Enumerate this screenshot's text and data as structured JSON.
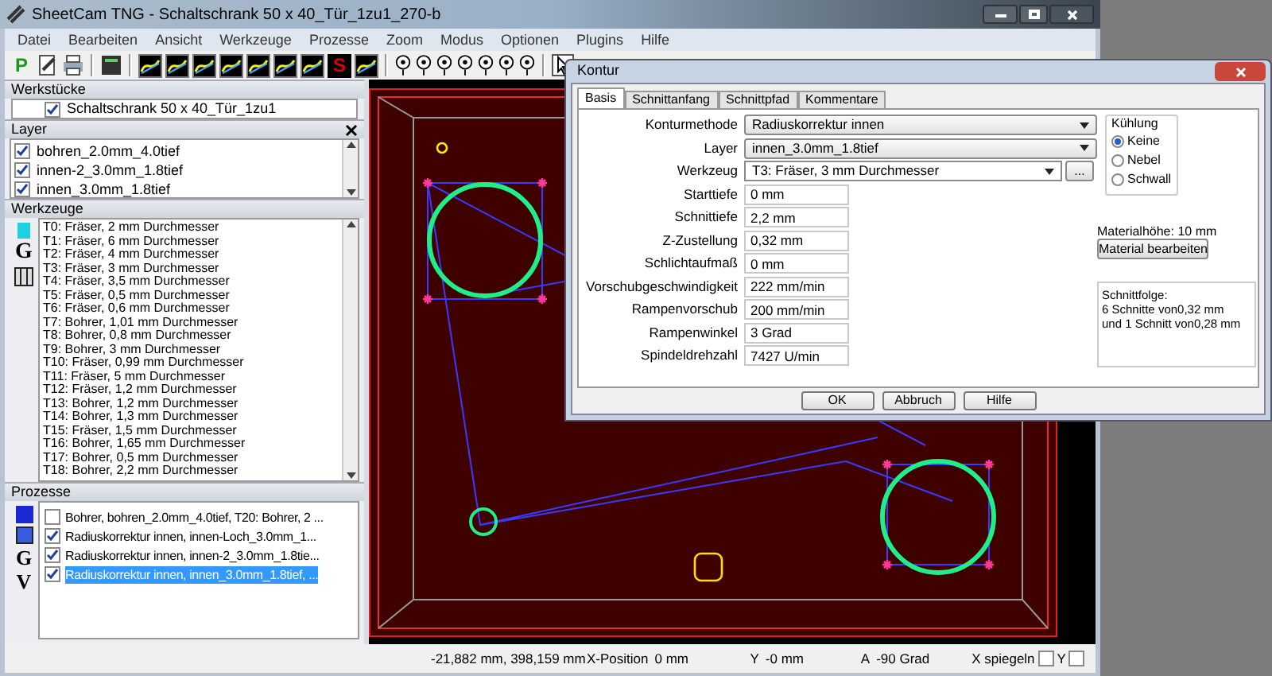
{
  "window": {
    "title": "SheetCam TNG - Schaltschrank 50 x 40_Tür_1zu1_270-b"
  },
  "menu": [
    "Datei",
    "Bearbeiten",
    "Ansicht",
    "Werkzeuge",
    "Prozesse",
    "Zoom",
    "Modus",
    "Optionen",
    "Plugins",
    "Hilfe"
  ],
  "toolbar": [
    {
      "kind": "glyph",
      "label": "P"
    },
    {
      "kind": "edit"
    },
    {
      "kind": "print"
    },
    {
      "kind": "sep"
    },
    {
      "kind": "table"
    },
    {
      "kind": "sep"
    },
    {
      "kind": "path"
    },
    {
      "kind": "path"
    },
    {
      "kind": "path"
    },
    {
      "kind": "path"
    },
    {
      "kind": "path"
    },
    {
      "kind": "path"
    },
    {
      "kind": "path"
    },
    {
      "kind": "glyph",
      "label": "S"
    },
    {
      "kind": "path"
    },
    {
      "kind": "sep"
    },
    {
      "kind": "pin"
    },
    {
      "kind": "pin"
    },
    {
      "kind": "pin"
    },
    {
      "kind": "pin"
    },
    {
      "kind": "pin"
    },
    {
      "kind": "pin"
    },
    {
      "kind": "pin"
    },
    {
      "kind": "sep"
    },
    {
      "kind": "pointer"
    }
  ],
  "werkstuecke": {
    "title": "Werkstücke",
    "items": [
      {
        "label": "Schaltschrank 50 x 40_Tür_1zu1",
        "checked": true
      }
    ]
  },
  "layer": {
    "title": "Layer",
    "items": [
      {
        "label": "bohren_2.0mm_4.0tief",
        "checked": true
      },
      {
        "label": "innen-2_3.0mm_1.8tief",
        "checked": true
      },
      {
        "label": "innen_3.0mm_1.8tief",
        "checked": true
      }
    ]
  },
  "werkzeuge": {
    "title": "Werkzeuge",
    "side_glyphs": [
      "G"
    ],
    "items": [
      "T0: Fräser, 2 mm Durchmesser",
      "T1: Fräser, 6 mm Durchmesser",
      "T2: Fräser, 4 mm Durchmesser",
      "T3: Fräser, 3 mm Durchmesser",
      "T4: Fräser, 3,5 mm Durchmesser",
      "T5: Fräser, 0,5 mm Durchmesser",
      "T6: Fräser, 0,6 mm Durchmesser",
      "T7: Bohrer, 1,01 mm Durchmesser",
      "T8: Bohrer, 0,8 mm Durchmesser",
      "T9: Bohrer, 3 mm Durchmesser",
      "T10: Fräser, 0,99 mm Durchmesser",
      "T11: Fräser, 5 mm Durchmesser",
      "T12: Fräser, 1,2 mm Durchmesser",
      "T13: Bohrer, 1,2 mm Durchmesser",
      "T14: Bohrer, 1,3 mm Durchmesser",
      "T15: Fräser, 1,5 mm Durchmesser",
      "T16: Bohrer, 1,65 mm Durchmesser",
      "T17: Bohrer, 0,5 mm Durchmesser",
      "T18: Bohrer, 2,2 mm Durchmesser"
    ]
  },
  "prozesse": {
    "title": "Prozesse",
    "side_glyphs": [
      "G",
      "V"
    ],
    "items": [
      {
        "label": "Bohrer, bohren_2.0mm_4.0tief, T20: Bohrer, 2 ...",
        "checked": false,
        "selected": false
      },
      {
        "label": "Radiuskorrektur innen, innen-Loch_3.0mm_1...",
        "checked": true,
        "selected": false
      },
      {
        "label": "Radiuskorrektur innen, innen-2_3.0mm_1.8tie...",
        "checked": true,
        "selected": false
      },
      {
        "label": "Radiuskorrektur innen, innen_3.0mm_1.8tief, ...",
        "checked": true,
        "selected": true
      }
    ]
  },
  "status_bar": {
    "coordinates": "-21,882 mm, 398,159 mm",
    "x_label": "X-Position",
    "x_value": "0 mm",
    "y_label": "Y",
    "y_value": "-0 mm",
    "a_label": "A",
    "a_value": "-90 Grad",
    "mirror_x": {
      "label": "X spiegeln",
      "checked": false
    },
    "mirror_y": {
      "label": "Y",
      "checked": false
    }
  },
  "dialog": {
    "title": "Kontur",
    "tabs": [
      {
        "label": "Basis",
        "selected": true
      },
      {
        "label": "Schnittanfang",
        "selected": false
      },
      {
        "label": "Schnittpfad",
        "selected": false
      },
      {
        "label": "Kommentare",
        "selected": false
      }
    ],
    "fields": [
      {
        "kind": "select",
        "label": "Konturmethode",
        "value": "Radiuskorrektur innen"
      },
      {
        "kind": "select",
        "label": "Layer",
        "value": "innen_3.0mm_1.8tief"
      },
      {
        "kind": "select_button",
        "label": "Werkzeug",
        "value": "T3: Fräser, 3 mm Durchmesser",
        "button": "..."
      },
      {
        "kind": "text",
        "label": "Starttiefe",
        "value": "0 mm"
      },
      {
        "kind": "text",
        "label": "Schnittiefe",
        "value": "2,2 mm"
      },
      {
        "kind": "text",
        "label": "Z-Zustellung",
        "value": "0,32 mm"
      },
      {
        "kind": "text",
        "label": "Schlichtaufmaß",
        "value": "0 mm"
      },
      {
        "kind": "text",
        "label": "Vorschubgeschwindigkeit",
        "value": "222 mm/min"
      },
      {
        "kind": "text",
        "label": "Rampenvorschub",
        "value": "200 mm/min"
      },
      {
        "kind": "text",
        "label": "Rampenwinkel",
        "value": "3 Grad"
      },
      {
        "kind": "text",
        "label": "Spindeldrehzahl",
        "value": "7427 U/min"
      }
    ],
    "cooling": {
      "title": "Kühlung",
      "options": [
        {
          "label": "Keine",
          "selected": true
        },
        {
          "label": "Nebel",
          "selected": false
        },
        {
          "label": "Schwall",
          "selected": false
        }
      ]
    },
    "material_height": "Materialhöhe: 10 mm",
    "material_button": "Material bearbeiten",
    "sequence": [
      "Schnittfolge:",
      "6 Schnitte von0,32 mm",
      "und 1 Schnitt von0,28 mm"
    ],
    "buttons": [
      "OK",
      "Abbruch",
      "Hilfe"
    ]
  }
}
